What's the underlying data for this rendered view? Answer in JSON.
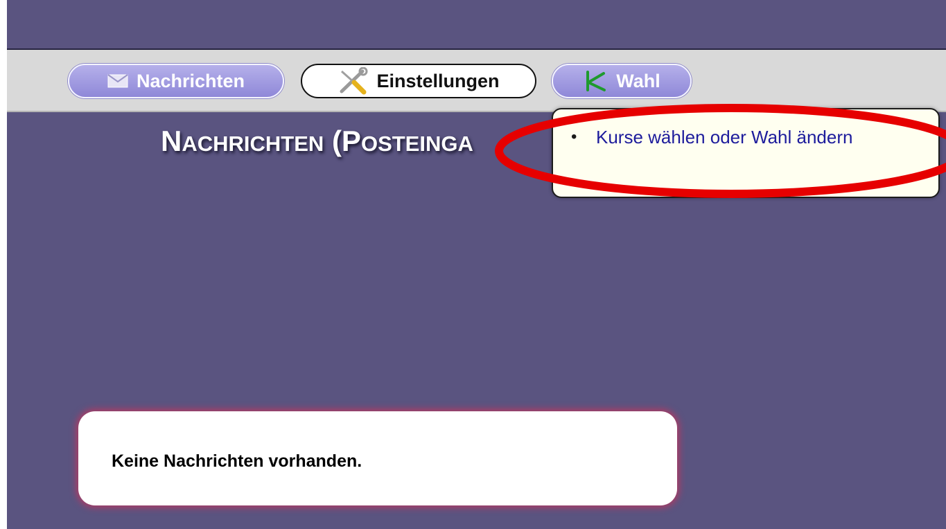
{
  "nav": {
    "nachrichten_label": "Nachrichten",
    "einstellungen_label": "Einstellungen",
    "wahl_label": "Wahl",
    "icons": [
      "envelope-icon",
      "tools-icon",
      "k-logo-icon"
    ]
  },
  "page": {
    "title_first_large": "N",
    "title_first_small": "ACHRICHTEN",
    "title_second_large": " (P",
    "title_second_small": "OSTEINGA"
  },
  "dropdown": {
    "items": [
      {
        "label": "Kurse wählen oder Wahl ändern"
      }
    ]
  },
  "message": {
    "text": "Keine Nachrichten vorhanden."
  },
  "colors": {
    "background": "#5a5480",
    "navbar": "#d9d9d9",
    "link": "#1d1c9c",
    "highlight": "#e60000",
    "message_glow": "#b23a63"
  }
}
